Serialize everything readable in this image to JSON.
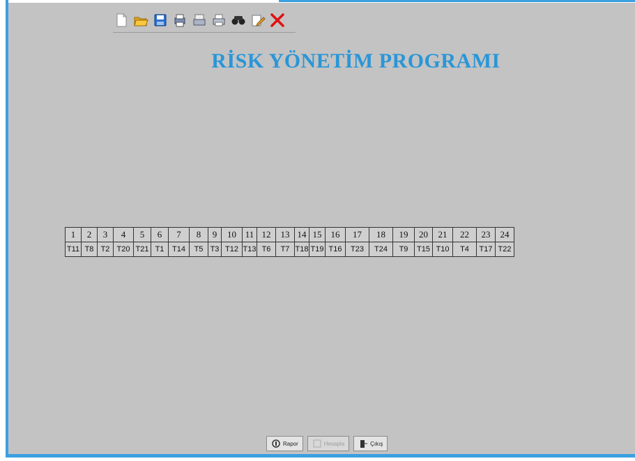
{
  "toolbar": {
    "icons": [
      "new-document-icon",
      "open-folder-icon",
      "save-icon",
      "print-preview-icon",
      "print-setup-icon",
      "print-icon",
      "binoculars-icon",
      "edit-icon",
      "close-icon"
    ]
  },
  "title": "RİSK YÖNETİM PROGRAMI",
  "grid": {
    "columns": [
      {
        "num": "1",
        "task": "T11"
      },
      {
        "num": "2",
        "task": "T8"
      },
      {
        "num": "3",
        "task": "T2"
      },
      {
        "num": "4",
        "task": "T20"
      },
      {
        "num": "5",
        "task": "T21"
      },
      {
        "num": "6",
        "task": "T1"
      },
      {
        "num": "7",
        "task": "T14"
      },
      {
        "num": "8",
        "task": "T5"
      },
      {
        "num": "9",
        "task": "T3"
      },
      {
        "num": "10",
        "task": "T12"
      },
      {
        "num": "11",
        "task": "T13"
      },
      {
        "num": "12",
        "task": "T6"
      },
      {
        "num": "13",
        "task": "T7"
      },
      {
        "num": "14",
        "task": "T18"
      },
      {
        "num": "15",
        "task": "T19"
      },
      {
        "num": "16",
        "task": "T16"
      },
      {
        "num": "17",
        "task": "T23"
      },
      {
        "num": "18",
        "task": "T24"
      },
      {
        "num": "19",
        "task": "T9"
      },
      {
        "num": "20",
        "task": "T15"
      },
      {
        "num": "21",
        "task": "T10"
      },
      {
        "num": "22",
        "task": "T4"
      },
      {
        "num": "23",
        "task": "T17"
      },
      {
        "num": "24",
        "task": "T22"
      }
    ]
  },
  "buttons": {
    "report": "Rapor",
    "middle": "Hesapla",
    "close": "Çıkış"
  },
  "colors": {
    "accent": "#2a96d8",
    "background": "#c3c3c3"
  }
}
